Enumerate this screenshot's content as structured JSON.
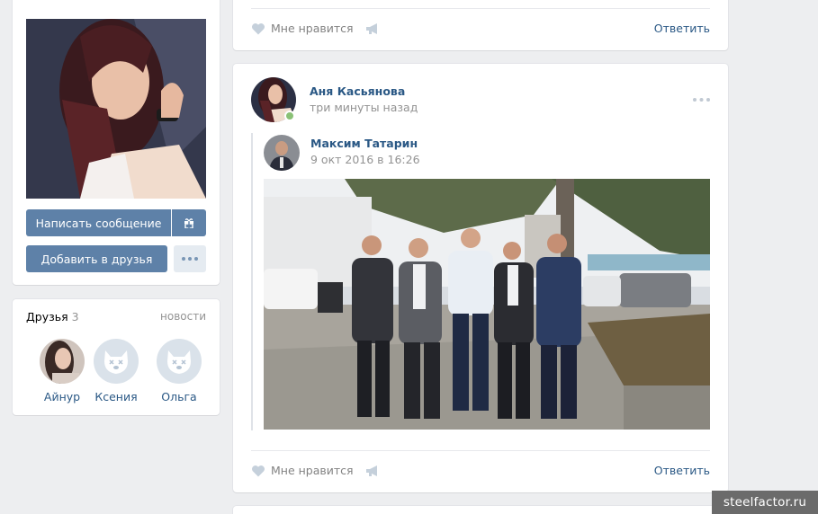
{
  "profile": {
    "message_button": "Написать сообщение",
    "gift_icon": "gift-icon",
    "add_friend_button": "Добавить в друзья",
    "more_icon": "more-dots-icon"
  },
  "friends": {
    "title": "Друзья",
    "count": "3",
    "news_link": "новости",
    "items": [
      {
        "name": "Айнур"
      },
      {
        "name": "Ксения"
      },
      {
        "name": "Ольга"
      }
    ]
  },
  "previous_post": {
    "like_label": "Мне нравится",
    "reply_label": "Ответить"
  },
  "post": {
    "author": "Аня Касьянова",
    "time": "три минуты назад",
    "repost": {
      "author": "Максим Татарин",
      "date": "9 окт 2016 в 16:26"
    },
    "like_label": "Мне нравится",
    "reply_label": "Ответить"
  },
  "watermark": "steelfactor.ru",
  "colors": {
    "link": "#2a5885",
    "button": "#5e81a8",
    "background": "#edeef0",
    "online": "#8ac176"
  }
}
